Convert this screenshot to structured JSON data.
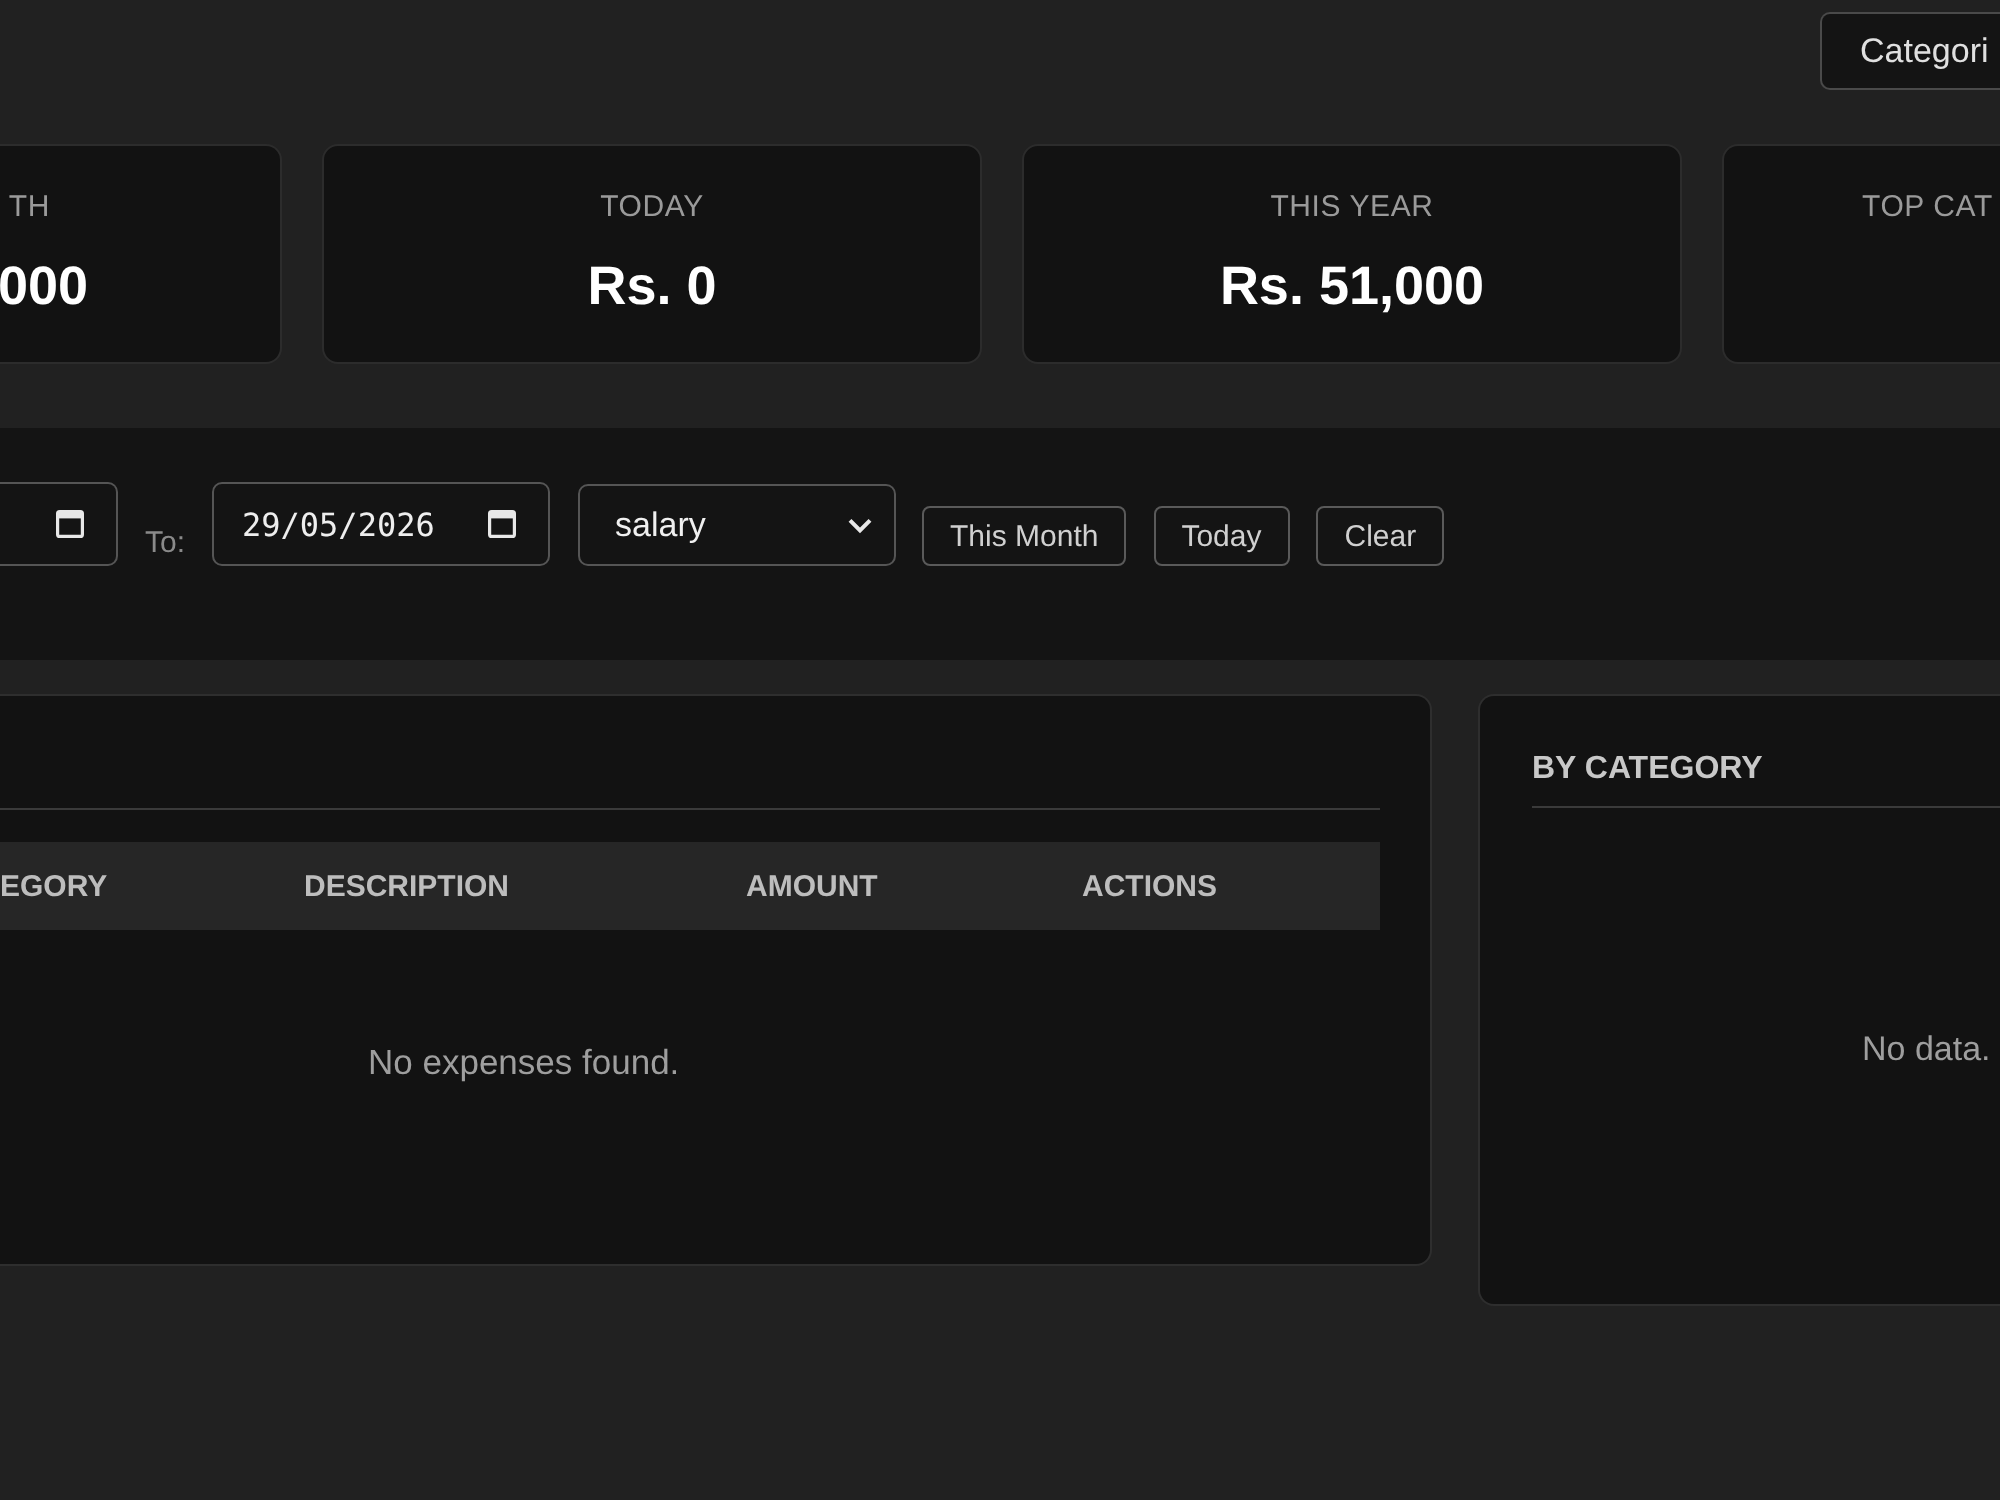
{
  "top_bar": {
    "button": "Categori"
  },
  "stats": [
    {
      "label": "TH",
      "value": "000"
    },
    {
      "label": "TODAY",
      "value": "Rs. 0"
    },
    {
      "label": "THIS YEAR",
      "value": "Rs. 51,000"
    },
    {
      "label": "TOP CAT"
    }
  ],
  "filters": [
    {
      "kind": "date"
    },
    {
      "kind": "label",
      "text": "To:"
    },
    {
      "kind": "date",
      "value": "29/05/2026"
    },
    {
      "kind": "select",
      "value": "salary"
    },
    {
      "kind": "button",
      "label": "This Month"
    },
    {
      "kind": "button",
      "label": "Today"
    },
    {
      "kind": "button",
      "label": "Clear"
    }
  ],
  "expenses_panel": {
    "columns": [
      "EGORY",
      "DESCRIPTION",
      "AMOUNT",
      "ACTIONS"
    ],
    "empty_message": "No expenses found."
  },
  "category_panel": {
    "title": "BY CATEGORY",
    "empty_message": "No data."
  }
}
